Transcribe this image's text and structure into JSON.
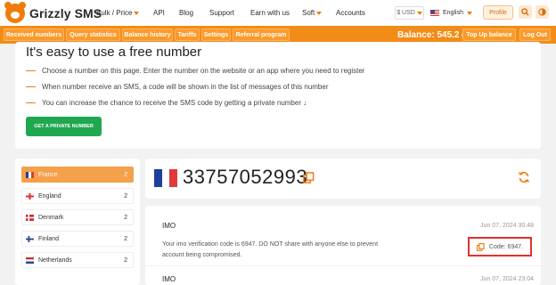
{
  "brand": {
    "name": "Grizzly SMS"
  },
  "nav": {
    "bulk_price": "Bulk / Price",
    "api": "API",
    "blog": "Blog",
    "support": "Support",
    "earn": "Earn with us",
    "soft": "Soft",
    "accounts": "Accounts",
    "currency": "$ USD",
    "language": "English",
    "profile": "Profile"
  },
  "tabs": [
    "Received numbers",
    "Query statistics",
    "Balance history",
    "Tariffs",
    "Settings",
    "Referral program"
  ],
  "balance": "Balance: 545.2 ₽",
  "topup": "Top Up balance",
  "logout": "Log Out",
  "info": {
    "title": "It's easy to use a free number",
    "bullets": [
      "Choose a number on this page. Enter the number on the website or an app where you need to register",
      "When number receive an SMS, a code will be shown in the list of messages of this number",
      "You can increase the chance to receive the SMS code by getting a private number ↓"
    ],
    "button": "GET A PRIVATE NUMBER"
  },
  "countries": [
    {
      "name": "France",
      "count": "2",
      "flag": "france-flag-icon"
    },
    {
      "name": "England",
      "count": "2",
      "flag": "england-flag-icon"
    },
    {
      "name": "Denmark",
      "count": "2",
      "flag": "denmark-flag-icon"
    },
    {
      "name": "Finland",
      "count": "2",
      "flag": "finland-flag-icon"
    },
    {
      "name": "Netherlands",
      "count": "2",
      "flag": "netherlands-flag-icon"
    }
  ],
  "number": {
    "value": "33757052993"
  },
  "messages": [
    {
      "sender": "IMO",
      "date": "Jun 07, 2024 30:48",
      "text": "Your imo verification code is 6947. DO NOT share with anyone else to prevent account being compromised.",
      "code": "Code: 6947."
    },
    {
      "sender": "IMO",
      "date": "Jun 07, 2024 23:04"
    }
  ],
  "colors": {
    "accent": "#f28c18",
    "green": "#1fa84f",
    "highlight": "#e33030"
  }
}
